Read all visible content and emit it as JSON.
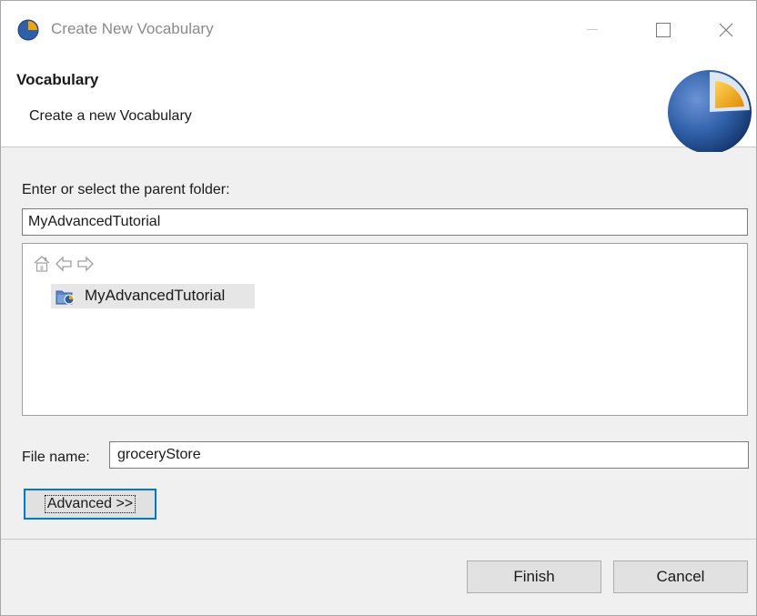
{
  "window": {
    "title": "Create New Vocabulary",
    "app_icon": "globe-icon",
    "controls": [
      "minimize-icon",
      "maximize-icon",
      "close-icon"
    ]
  },
  "banner": {
    "title": "Vocabulary",
    "description": "Create a new Vocabulary",
    "graphic": "sphere-graphic"
  },
  "form": {
    "folder_label": "Enter or select the parent folder:",
    "folder_value": "MyAdvancedTutorial",
    "tree_toolbar": [
      "home-icon",
      "back-arrow-icon",
      "forward-arrow-icon"
    ],
    "tree_items": [
      {
        "label": "MyAdvancedTutorial",
        "icon": "project-folder-icon",
        "selected": true
      }
    ],
    "file_name_label": "File name:",
    "file_name_value": "groceryStore",
    "advanced_label": "Advanced >>"
  },
  "footer": {
    "finish_label": "Finish",
    "cancel_label": "Cancel"
  },
  "colors": {
    "accent": "#0078d7",
    "sphere_blue": "#2f5fa8",
    "sphere_orange": "#f0a500",
    "selection": "#e6e6e6"
  }
}
